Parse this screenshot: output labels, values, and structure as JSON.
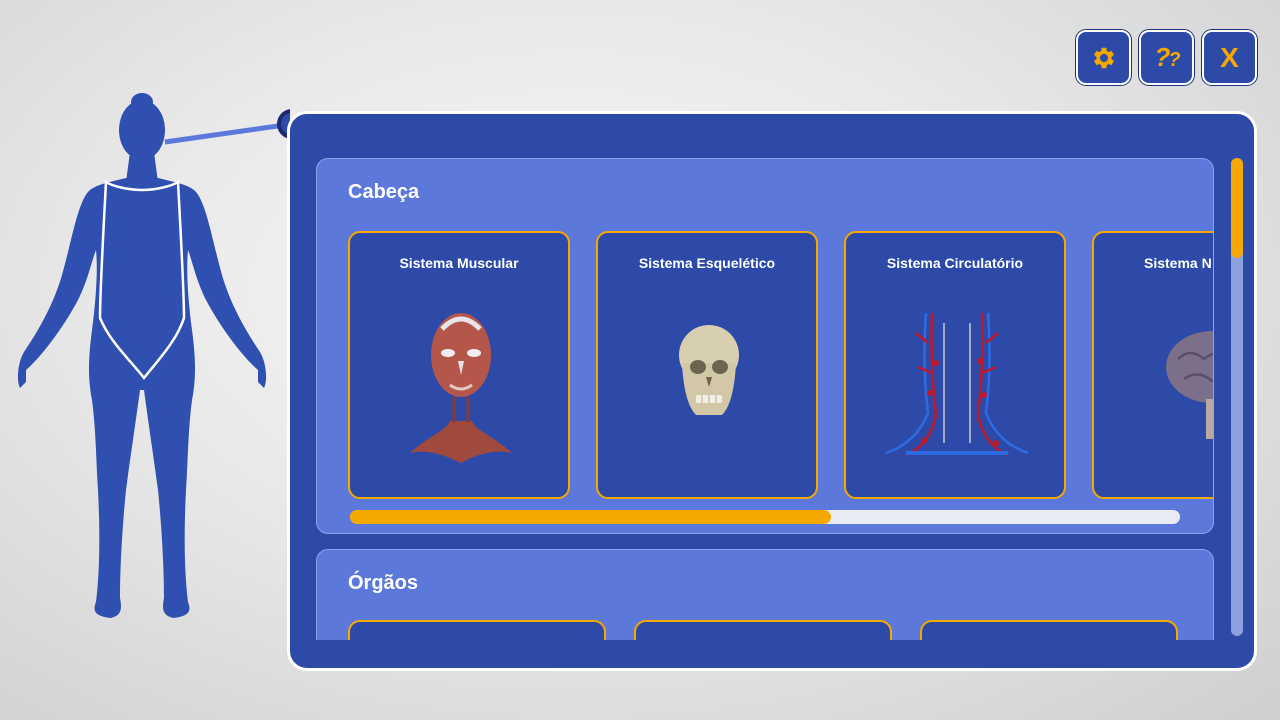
{
  "toolbar": {
    "settings_icon": "gear-icon",
    "help_label": "?",
    "help_label2": "?",
    "close_label": "X"
  },
  "sections": [
    {
      "title": "Cabeça",
      "cards": [
        {
          "label": "Sistema Muscular",
          "icon": "muscle-head-image"
        },
        {
          "label": "Sistema Esquelético",
          "icon": "skull-image"
        },
        {
          "label": "Sistema Circulatório",
          "icon": "circulatory-image"
        },
        {
          "label": "Sistema N",
          "icon": "brain-image"
        }
      ],
      "scroll_progress": 0.58
    },
    {
      "title": "Órgãos"
    }
  ],
  "panel_scroll_progress": 0.0,
  "colors": {
    "primary": "#2e4aa8",
    "section": "#5b78da",
    "accent": "#f5a800",
    "silhouette": "#2f4fb1"
  }
}
